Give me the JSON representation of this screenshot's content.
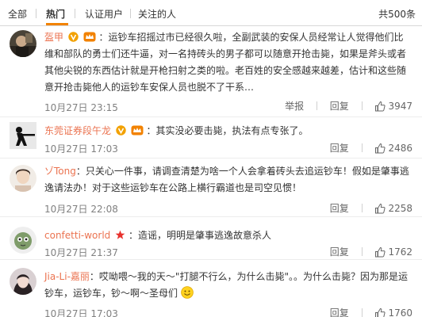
{
  "tabs": [
    {
      "label": "全部"
    },
    {
      "label": "热门"
    },
    {
      "label": "认证用户"
    },
    {
      "label": "关注的人"
    }
  ],
  "total_count": "共500条",
  "action_labels": {
    "report": "举报",
    "reply": "回复"
  },
  "colors": {
    "accent": "#f28200",
    "username": "#eb7350",
    "badge_v": "#f2a100"
  },
  "comments": [
    {
      "username": "盔甲",
      "badges": [
        "vip-v-badge",
        "member-crown-badge"
      ],
      "text": "：运钞车招摇过市已经很久啦，全副武装的安保人员经常让人觉得他们比维和部队的勇士们还牛逼，对一名持砖头的男子都可以随意开抢击毙，如果是斧头或者其他尖锐的东西估计就是开枪扫射之类的啦。老百姓的安全感越来越差，估计和这些随意开抢击毙他人的运钞车安保人员也脱不了干系…",
      "time": "10月27日 23:15",
      "likes": "3947"
    },
    {
      "username": "东莞证券段午龙",
      "badges": [
        "vip-v-badge",
        "member-crown-badge"
      ],
      "text": "：其实没必要击毙，执法有点专张了。",
      "time": "10月27日 17:03",
      "likes": "2486"
    },
    {
      "username": "ゾTong",
      "badges": [],
      "text": "：只关心一件事，请调查清楚为啥一个人会拿着砖头去追运钞车！假如是肇事逃逸请法办！对于这些运钞车在公路上横行霸道也是司空见惯！",
      "time": "10月27日 22:08",
      "likes": "2258"
    },
    {
      "username": "confetti-world",
      "badges": [
        "red-star-badge"
      ],
      "text": "：造谣，明明是肇事逃逸故意杀人",
      "time": "10月27日 21:37",
      "likes": "1762"
    },
    {
      "username": "Jia-Li-嘉丽",
      "badges": [],
      "text": "：哎呦喂～我的天～\"打腿不行么，为什么击毙\"。。为什么击毙？因为那是运钞车，运钞车，钞～啊～圣母们",
      "emoji": "smiley-emoji",
      "time": "10月27日 17:03",
      "likes": "1760"
    }
  ]
}
